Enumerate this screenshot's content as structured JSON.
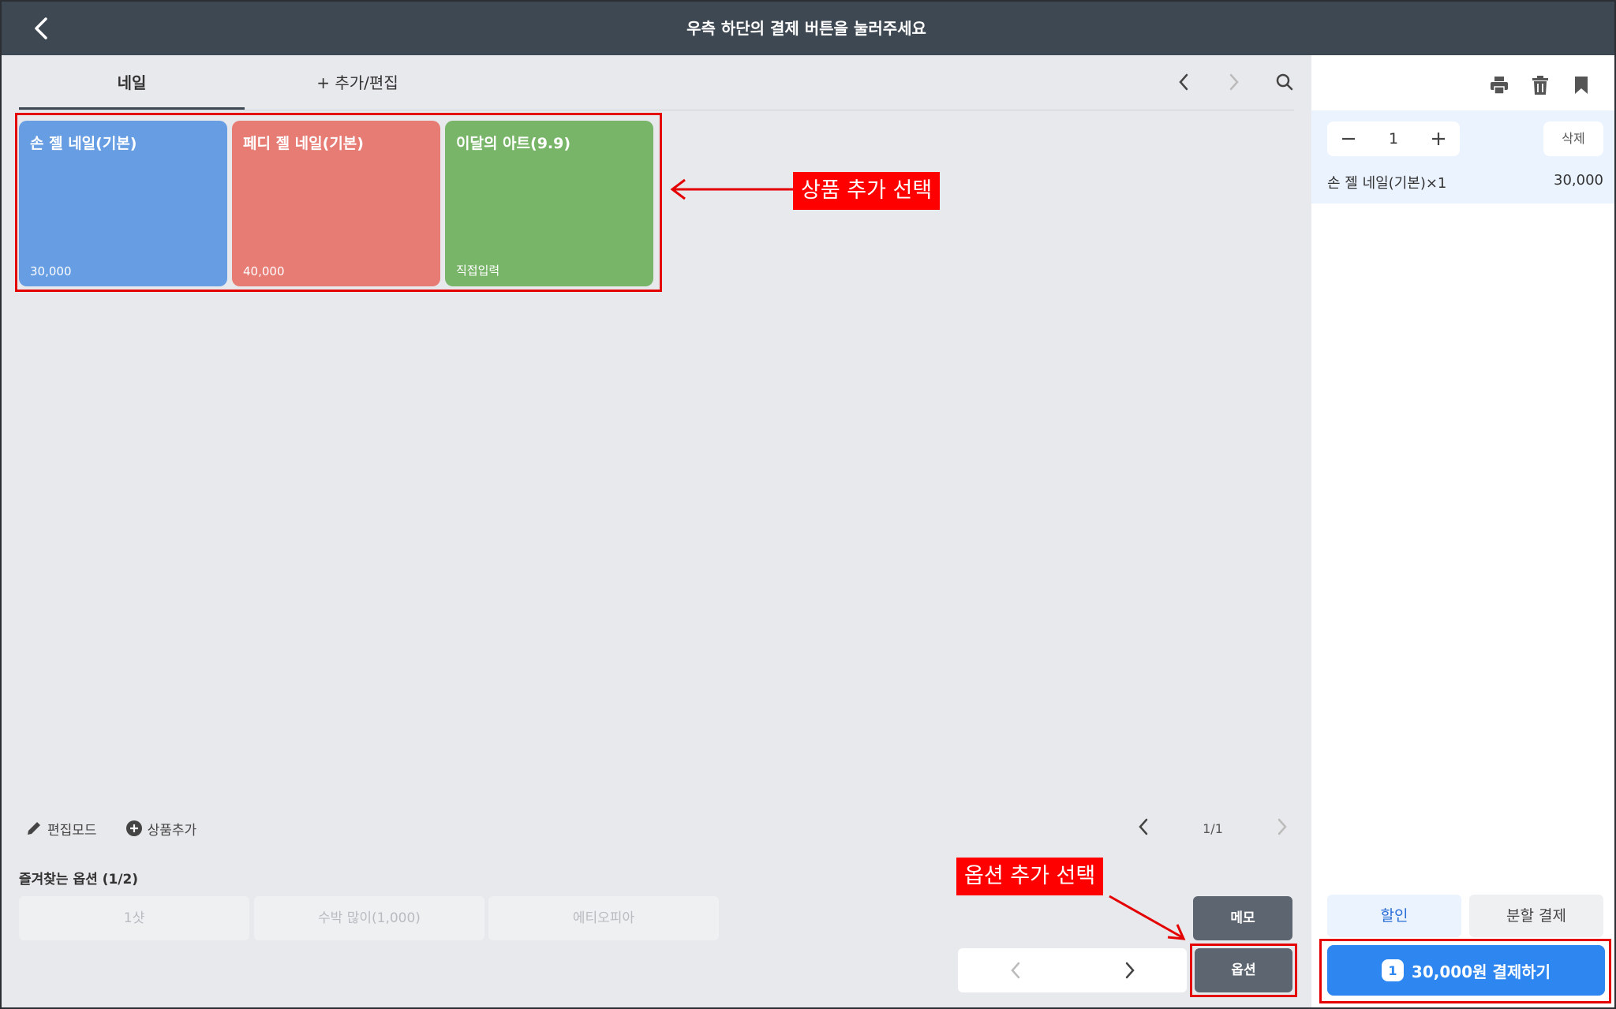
{
  "header": {
    "title": "우측 하단의 결제 버튼을 눌러주세요"
  },
  "tabs": [
    {
      "label": "네일"
    },
    {
      "label": "+ 추가/편집"
    }
  ],
  "products": [
    {
      "name": "손 젤 네일(기본)",
      "price": "30,000",
      "color": "#679de3"
    },
    {
      "name": "페디 젤 네일(기본)",
      "price": "40,000",
      "color": "#e77c75"
    },
    {
      "name": "이달의 아트(9.9)",
      "price": "직접입력",
      "color": "#79b569"
    }
  ],
  "annotations": {
    "product_add": "상품 추가 선택",
    "option_add": "옵션 추가 선택"
  },
  "toolbar": {
    "edit_mode": "편집모드",
    "add_product": "상품추가"
  },
  "pager": {
    "text": "1/1"
  },
  "favorites": {
    "label": "즐겨찾는 옵션 (1/2)",
    "options": [
      "1샷",
      "수박 많이(1,000)",
      "에티오피아"
    ]
  },
  "buttons": {
    "memo": "메모",
    "option": "옵션"
  },
  "cart": {
    "quantity": "1",
    "delete_label": "삭제",
    "item_name": "손 젤 네일(기본)×1",
    "item_price": "30,000",
    "discount_label": "할인",
    "split_label": "분할 결제",
    "pay_count": "1",
    "pay_label": "30,000원 결제하기"
  },
  "colors": {
    "header": "#3d4852",
    "accent": "#2e86f0",
    "annotation": "#ff0000"
  }
}
